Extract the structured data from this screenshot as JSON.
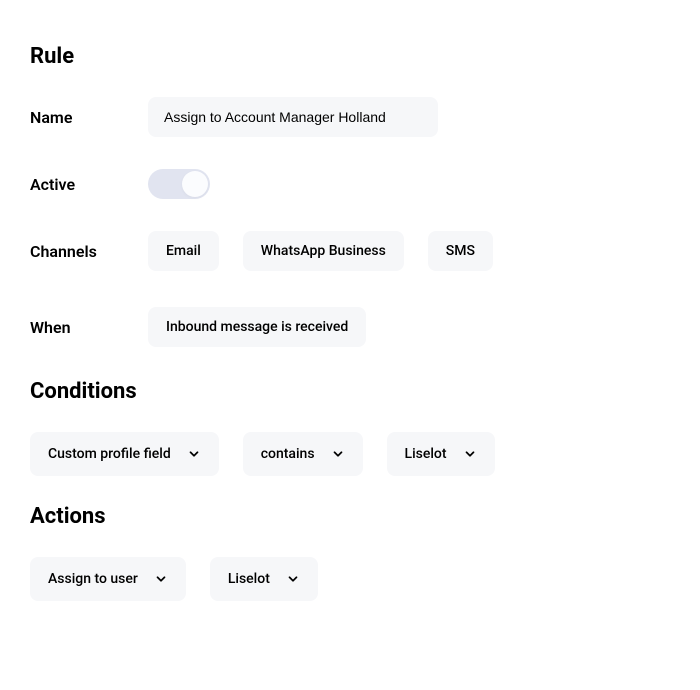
{
  "rule": {
    "title": "Rule",
    "name_label": "Name",
    "name_value": "Assign to Account Manager Holland",
    "active_label": "Active",
    "active_value": true,
    "channels_label": "Channels",
    "channels": [
      "Email",
      "WhatsApp Business",
      "SMS"
    ],
    "when_label": "When",
    "when_value": "Inbound message is received"
  },
  "conditions": {
    "title": "Conditions",
    "items": [
      {
        "label": "Custom profile field"
      },
      {
        "label": "contains"
      },
      {
        "label": "Liselot"
      }
    ]
  },
  "actions": {
    "title": "Actions",
    "items": [
      {
        "label": "Assign to user"
      },
      {
        "label": "Liselot"
      }
    ]
  }
}
